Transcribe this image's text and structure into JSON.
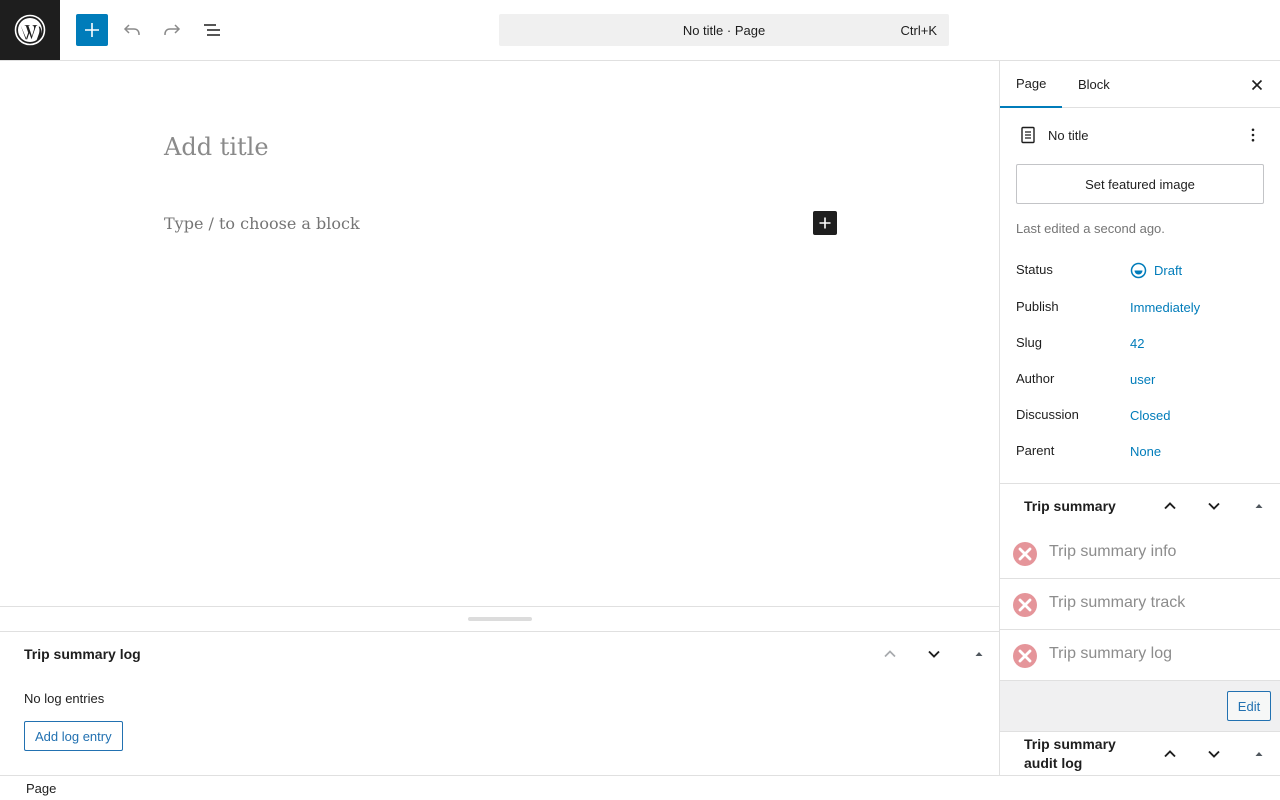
{
  "topbar": {
    "command_title": "No title · Page",
    "command_shortcut": "Ctrl+K"
  },
  "canvas": {
    "title_placeholder": "Add title",
    "block_placeholder": "Type / to choose a block"
  },
  "bottom_metabox": {
    "title": "Trip summary log",
    "empty_text": "No log entries",
    "add_button": "Add log entry"
  },
  "footer": {
    "breadcrumb": "Page"
  },
  "sidebar": {
    "tabs": [
      "Page",
      "Block"
    ],
    "post_title": "No title",
    "featured_image_button": "Set featured image",
    "last_edited": "Last edited a second ago.",
    "rows": {
      "status": {
        "label": "Status",
        "value": "Draft"
      },
      "publish": {
        "label": "Publish",
        "value": "Immediately"
      },
      "slug": {
        "label": "Slug",
        "value": "42"
      },
      "author": {
        "label": "Author",
        "value": "user"
      },
      "discussion": {
        "label": "Discussion",
        "value": "Closed"
      },
      "parent": {
        "label": "Parent",
        "value": "None"
      }
    },
    "trip_panel": {
      "title": "Trip summary",
      "items": [
        "Trip summary info",
        "Trip summary track",
        "Trip summary log"
      ],
      "edit_button": "Edit"
    },
    "audit_panel": {
      "title": "Trip summary audit log"
    }
  },
  "colors": {
    "accent": "#007cba",
    "error": "#e26f76",
    "dark": "#1e1e1e"
  }
}
